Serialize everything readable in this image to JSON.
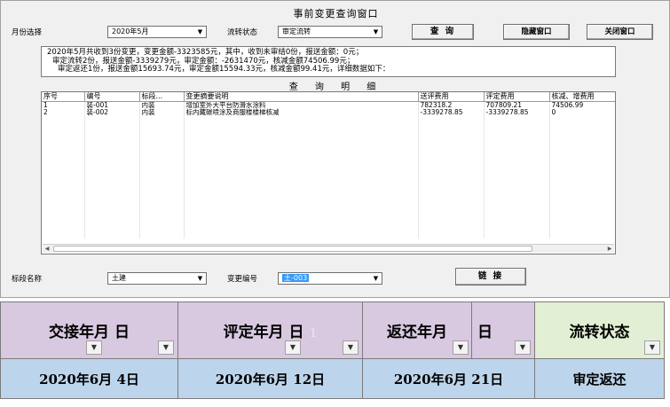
{
  "window": {
    "title": "事前变更查询窗口",
    "month_label": "月份选择",
    "month_value": "2020年5月",
    "status_label": "流转状态",
    "status_value": "审定流转",
    "query_button": "查  询",
    "hide_button": "隐藏窗口",
    "close_button": "关闭窗口"
  },
  "summary": {
    "line1": "2020年5月共收到3份变更，变更金额-3323585元，其中，收到未审结0份，报送金额：0元；",
    "line2": "审定流转2份，报送金额-3339279元，审定金额：-2631470元，核减金额74506.99元；",
    "line3": "审定返还1份，报送金额15693.74元，审定金额15594.33元，核减金额99.41元，详细数据如下："
  },
  "subtitle": "查 询 明 细",
  "table": {
    "columns": [
      "序号",
      "编号",
      "标段...",
      "变更摘要说明",
      "送评费用",
      "评定费用",
      "核减、增费用"
    ],
    "rows": [
      [
        "1",
        "装-001",
        "内装",
        "增加室外大平台防滑水涂料",
        "782318.2",
        "707809.21",
        "74506.99"
      ],
      [
        "2",
        "装-002",
        "内装",
        "标内藏碳喷涂及商服楼楼梯核减",
        "-3339278.85",
        "-3339278.85",
        "0"
      ]
    ]
  },
  "bottom": {
    "section_label": "标段名称",
    "section_value": "土建",
    "change_label": "变更编号",
    "change_value": "土-003",
    "link_button": "链  接"
  },
  "sheet": {
    "headers": [
      "交接年月 日",
      "评定年月 日",
      "返还年月",
      "日",
      "流转状态"
    ],
    "faint_mark": "1",
    "values": [
      "2020年6月 4日",
      "2020年6月 12日",
      "2020年6月 21日",
      "审定返还"
    ]
  },
  "icons": {
    "dropdown": "chevron-down-icon"
  }
}
